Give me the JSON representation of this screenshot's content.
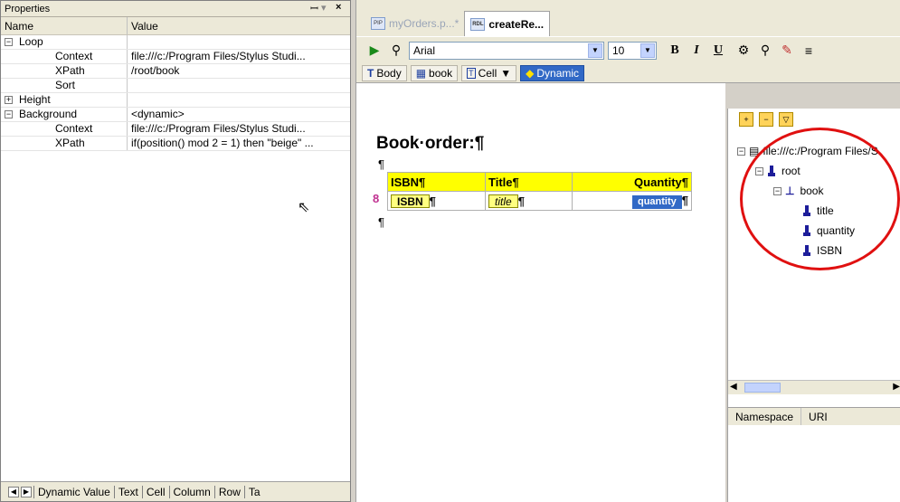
{
  "properties": {
    "title": "Properties",
    "pin_glyph": "⬾",
    "close_glyph": "×",
    "columns": [
      "Name",
      "Value"
    ],
    "rows": [
      {
        "name": "Loop",
        "value": "",
        "expander": "−",
        "indent": false
      },
      {
        "name": "Context",
        "value": "file:///c:/Program Files/Stylus Studi...",
        "expander": "",
        "indent": true
      },
      {
        "name": "XPath",
        "value": "/root/book",
        "expander": "",
        "indent": true
      },
      {
        "name": "Sort",
        "value": "",
        "expander": "",
        "indent": true
      },
      {
        "name": "Height",
        "value": "",
        "expander": "+",
        "indent": false
      },
      {
        "name": "Background",
        "value": "<dynamic>",
        "expander": "−",
        "indent": false
      },
      {
        "name": "Context",
        "value": "file:///c:/Program Files/Stylus Studi...",
        "expander": "",
        "indent": true
      },
      {
        "name": "XPath",
        "value": "if(position() mod 2 = 1) then \"beige\" ...",
        "expander": "",
        "indent": true
      }
    ],
    "bottom_tabs": [
      "Dynamic Value",
      "Text",
      "Cell",
      "Column",
      "Row",
      "Ta"
    ]
  },
  "editor": {
    "doc_tabs": [
      {
        "label": "myOrders.p...*",
        "icon": "PIP",
        "active": false
      },
      {
        "label": "createRe...",
        "icon": "RDL",
        "active": true
      }
    ],
    "toolbar": {
      "font": "Arial",
      "size": "10",
      "bold": "B",
      "italic": "I",
      "underline": "U"
    },
    "context_bar": {
      "body": "Body",
      "book": "book",
      "cell": "Cell",
      "dynamic": "Dynamic"
    },
    "document": {
      "title": "Book·order:¶",
      "pilcrow": "¶",
      "headers": [
        "ISBN¶",
        "Title¶",
        "Quantity¶"
      ],
      "cells": [
        "ISBN",
        "title",
        "quantity"
      ],
      "loop_marker": "8"
    }
  },
  "schema": {
    "root_uri": "file:///c:/Program Files/S",
    "nodes": [
      "root",
      "book",
      "title",
      "quantity",
      "ISBN"
    ],
    "namespace_columns": [
      "Namespace",
      "URI"
    ]
  },
  "colors": {
    "highlight": "#ffff00",
    "dynamic": "#3169c6",
    "circle": "#e01010"
  }
}
